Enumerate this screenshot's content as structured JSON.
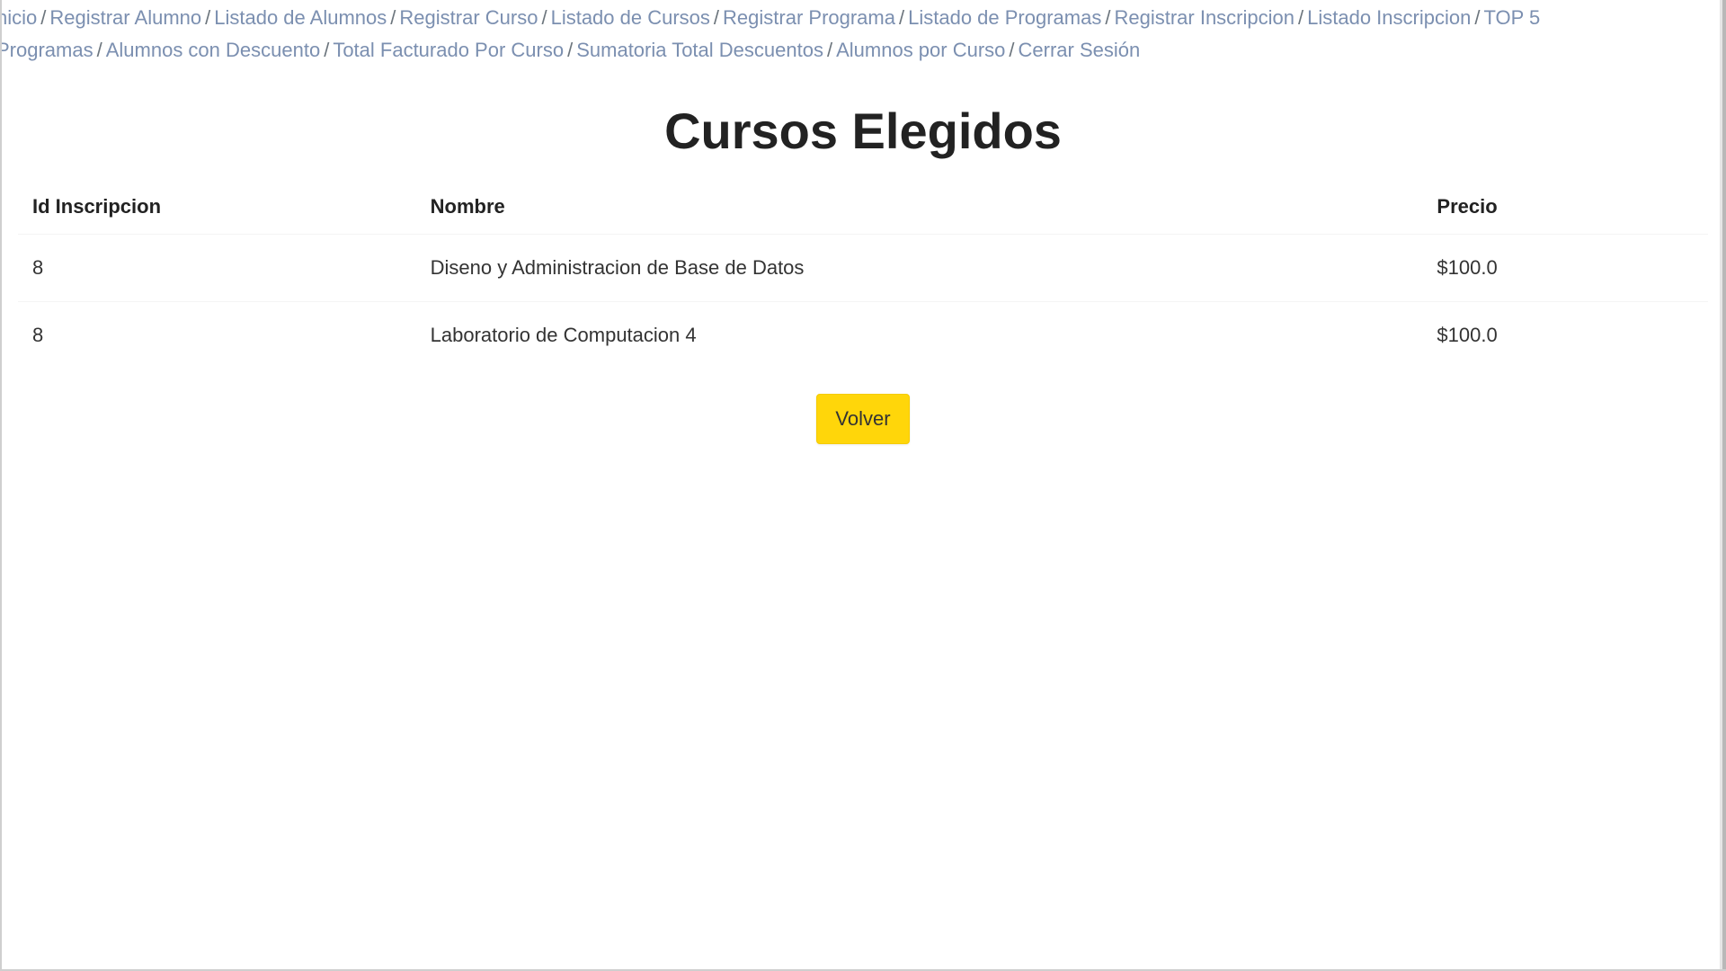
{
  "nav": {
    "items": [
      {
        "label": "nicio",
        "active": false
      },
      {
        "label": "Registrar Alumno",
        "active": false
      },
      {
        "label": "Listado de Alumnos",
        "active": false
      },
      {
        "label": "Registrar Curso",
        "active": false
      },
      {
        "label": "Listado de Cursos",
        "active": false
      },
      {
        "label": "Registrar Programa",
        "active": false
      },
      {
        "label": "Listado de Programas",
        "active": false
      },
      {
        "label": "Registrar Inscripcion",
        "active": false
      },
      {
        "label": "Listado Inscripcion",
        "active": false
      },
      {
        "label": "TOP 5 Programas",
        "active": false
      },
      {
        "label": "Alumnos con Descuento",
        "active": false
      },
      {
        "label": "Total Facturado Por Curso",
        "active": false
      },
      {
        "label": "Sumatoria Total Descuentos",
        "active": false
      },
      {
        "label": "Alumnos por Curso",
        "active": false
      },
      {
        "label": "Cerrar Sesión",
        "active": false
      }
    ],
    "separator": "/"
  },
  "page": {
    "title": "Cursos Elegidos"
  },
  "table": {
    "headers": {
      "id": "Id Inscripcion",
      "name": "Nombre",
      "price": "Precio"
    },
    "rows": [
      {
        "id": "8",
        "name": "Diseno y Administracion de Base de Datos",
        "price": "$100.0"
      },
      {
        "id": "8",
        "name": "Laboratorio de Computacion 4",
        "price": "$100.0"
      }
    ]
  },
  "actions": {
    "back_label": "Volver"
  },
  "colors": {
    "link": "#7b8fb0",
    "button_bg": "#ffd60a",
    "title": "#222222"
  }
}
